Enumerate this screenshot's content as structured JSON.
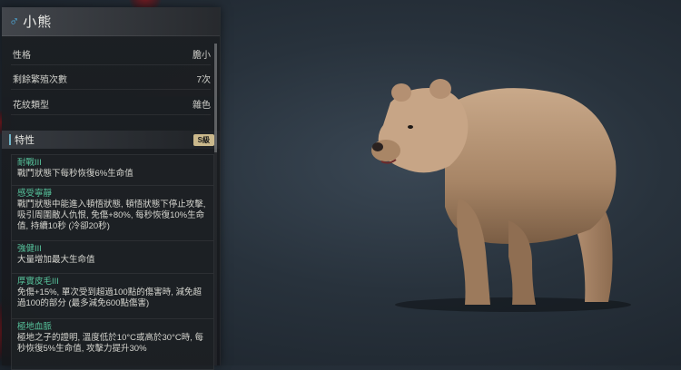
{
  "panel": {
    "title": "小熊",
    "gender_icon": "male-icon",
    "attributes": [
      {
        "label": "性格",
        "value": "膽小"
      },
      {
        "label": "剩餘繁殖次數",
        "value": "7次"
      },
      {
        "label": "花紋類型",
        "value": "雜色"
      }
    ],
    "traits_section": {
      "title": "特性",
      "grade": "S級"
    },
    "traits": [
      {
        "name": "耐戰III",
        "desc": "戰鬥狀態下每秒恢復6%生命值"
      },
      {
        "name": "感受寧靜",
        "desc": "戰鬥狀態中能進入頓悟狀態, 頓悟狀態下停止攻擊, 吸引周圍敵人仇恨, 免傷+80%, 每秒恢復10%生命值, 持續10秒 (冷卻20秒)"
      },
      {
        "name": "強健III",
        "desc": "大量增加最大生命值"
      },
      {
        "name": "厚實皮毛III",
        "desc": "免傷+15%, 單次受到超過100點的傷害時, 減免超過100的部分 (最多減免600點傷害)"
      },
      {
        "name": "極地血脈",
        "desc": "極地之子的證明, 溫度低於10°C或高於30°C時, 每秒恢復5%生命值, 攻擊力提升30%"
      }
    ]
  },
  "colors": {
    "trait_name": "#57c39c",
    "gender": "#4fb3e6",
    "grade_badge": "#cbb98c"
  }
}
